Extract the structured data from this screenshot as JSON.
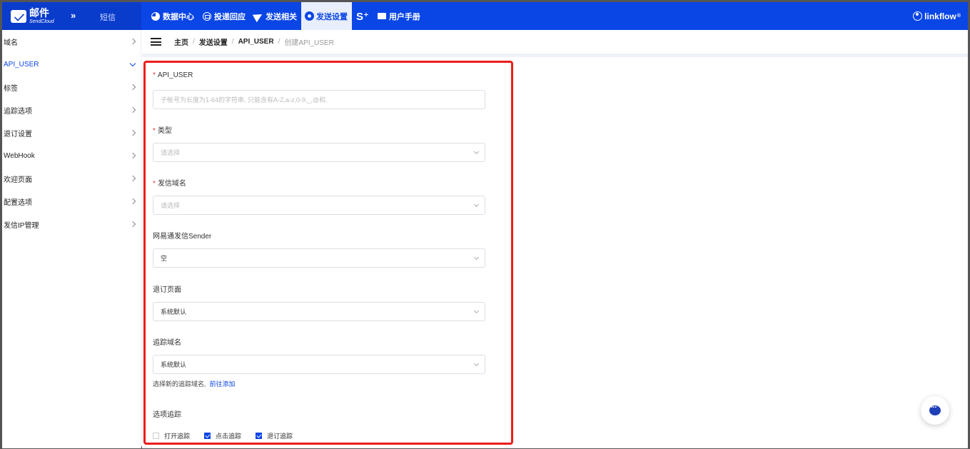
{
  "topbar": {
    "brand_name": "邮件",
    "brand_sub": "SendCloud",
    "brand_toggle": "»",
    "sms": "短信",
    "nav": [
      {
        "label": "数据中心",
        "icon": "pie-chart-icon"
      },
      {
        "label": "投递回应",
        "icon": "mail-response-icon"
      },
      {
        "label": "发送相关",
        "icon": "paper-plane-icon"
      },
      {
        "label": "发送设置",
        "icon": "gear-icon",
        "active": true
      },
      {
        "label": "",
        "icon": "s-plus-icon"
      },
      {
        "label": "用户手册",
        "icon": "folder-icon"
      }
    ],
    "s_glyph": "S⁺",
    "user": "linkflow",
    "user_badge": "®"
  },
  "sidebar": {
    "items": [
      {
        "label": "域名"
      },
      {
        "label": "API_USER",
        "active": true
      },
      {
        "label": "标签"
      },
      {
        "label": "追踪选项"
      },
      {
        "label": "退订设置"
      },
      {
        "label": "WebHook"
      },
      {
        "label": "欢迎页面"
      },
      {
        "label": "配置选项"
      },
      {
        "label": "发信IP管理"
      }
    ]
  },
  "breadcrumb": {
    "items": [
      "主页",
      "发送设置",
      "API_USER"
    ],
    "current": "创建API_USER",
    "sep": "/"
  },
  "form": {
    "api_user": {
      "label": "API_USER",
      "required": "*",
      "placeholder": "子帐号为长度为1-64的字符串, 只能含有A-Z,a-z,0-9,_,@和."
    },
    "type": {
      "label": "类型",
      "required": "*",
      "placeholder": "请选择"
    },
    "domain": {
      "label": "发信域名",
      "required": "*",
      "placeholder": "请选择"
    },
    "sender": {
      "label": "网易通发信Sender",
      "value": "空"
    },
    "unsubscribe": {
      "label": "退订页面",
      "value": "系统默认"
    },
    "tracking_domain": {
      "label": "追踪域名",
      "value": "系统默认"
    },
    "hint": {
      "text": "选择新的追踪域名,",
      "link": "前往添加"
    },
    "tracking": {
      "label": "选项追踪",
      "options": [
        {
          "label": "打开追踪",
          "checked": false
        },
        {
          "label": "点击追踪",
          "checked": true
        },
        {
          "label": "退订追踪",
          "checked": true
        }
      ]
    }
  },
  "colors": {
    "brand": "#0a45e6",
    "highlight_border": "#ec1c1c"
  }
}
